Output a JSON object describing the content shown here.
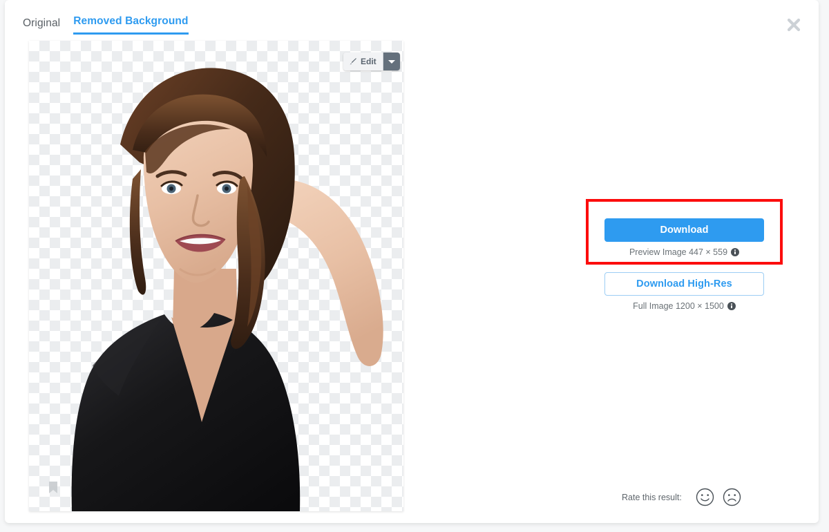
{
  "app": {
    "accent_color": "#2e9bf0",
    "annotation_color": "#fc0d0d",
    "background_color": "#ffffff"
  },
  "tabs": [
    {
      "label": "Original",
      "active": false,
      "name": "tab-original"
    },
    {
      "label": "Removed Background",
      "active": true,
      "name": "tab-removed-background"
    }
  ],
  "close": {
    "icon": "close-icon",
    "label": "✕"
  },
  "preview": {
    "edit_button": {
      "label": "Edit",
      "icon": "brush-icon",
      "caret_icon": "chevron-down-icon"
    },
    "bookmark_icon": "bookmark-icon",
    "checker_background": true
  },
  "actions": {
    "download": {
      "label": "Download",
      "caption": "Preview Image 447 × 559",
      "info_icon": "info-icon"
    },
    "download_high_res": {
      "label": "Download High-Res",
      "caption": "Full Image 1200 × 1500",
      "info_icon": "info-icon"
    }
  },
  "rating": {
    "label": "Rate this result:",
    "positive_icon": "smiley-happy-icon",
    "negative_icon": "smiley-sad-icon"
  }
}
